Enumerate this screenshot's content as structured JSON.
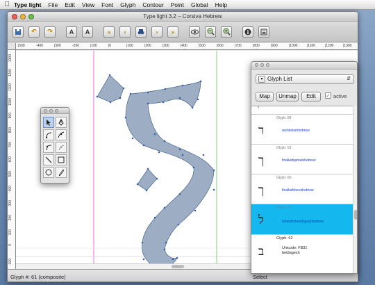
{
  "menu": {
    "app": "Type light",
    "items": [
      "File",
      "Edit",
      "View",
      "Font",
      "Glyph",
      "Contour",
      "Point",
      "Global",
      "Help"
    ]
  },
  "window": {
    "title": "Type light 3.2  –  Corsiva Hebrew"
  },
  "toolbar": {
    "buttons": [
      "save-icon",
      "undo-icon",
      "redo-icon",
      "add-point-icon",
      "add-guide-icon",
      "first-glyph-icon",
      "previous-glyph-icon",
      "binoculars-icon",
      "next-glyph-icon",
      "last-glyph-icon",
      "eye-icon",
      "zoom-out-icon",
      "zoom-in-icon",
      "info-icon",
      "list-icon"
    ]
  },
  "ruler": {
    "h_labels": [
      "|500",
      "-400",
      "|300",
      "-200",
      "|100",
      "|0",
      "|100",
      "|200",
      "|300",
      "|400",
      "|500",
      "|600",
      "|700",
      "|800",
      "|900",
      "|1000",
      "|1100",
      "|1200",
      "|1300"
    ],
    "v_labels": [
      "1300",
      "1200",
      "1100",
      "1000",
      "900",
      "800",
      "700",
      "600",
      "500",
      "400",
      "300",
      "200",
      "100",
      "0",
      "-100"
    ]
  },
  "status": {
    "glyph": "Glyph #: 61  (composite)",
    "tool": "Select"
  },
  "glyph_list": {
    "selector_label": "Glyph List",
    "buttons": {
      "map": "Map",
      "unmap": "Unmap",
      "edit": "Edit"
    },
    "active_label": "active",
    "active_checked": true,
    "rows": [
      {
        "num": "",
        "name": "",
        "glyph": "ְ",
        "selected": false
      },
      {
        "num": "Glyph: 58",
        "name": "reshholamhebrew",
        "glyph": "ר",
        "selected": false
      },
      {
        "num": "Glyph: 59",
        "name": "finalkafqamatshebrew",
        "glyph": "ך",
        "selected": false
      },
      {
        "num": "Glyph: 60",
        "name": "finalkafshevahebrew",
        "glyph": "ך",
        "selected": false
      },
      {
        "num": "Glyph: 61",
        "name": "lamedholamdageshhebrew",
        "glyph": "ל",
        "selected": true
      },
      {
        "num": "Glyph: 62",
        "name": "Unicode: FB31",
        "name2": "betdagesh",
        "glyph": "ב",
        "selected": false
      }
    ]
  },
  "colors": {
    "glyph_fill": "#9daec4",
    "selection": "#14b8ee",
    "guide_magenta": "#d84fd8",
    "guide_green": "#55c855"
  }
}
